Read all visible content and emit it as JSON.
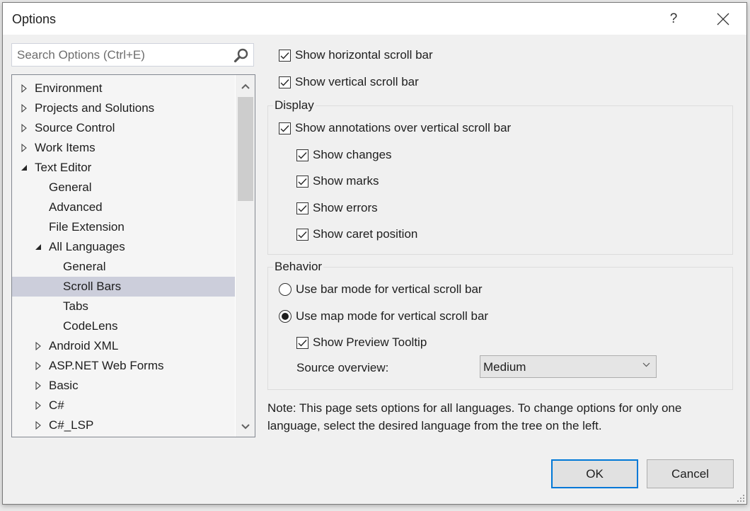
{
  "window": {
    "title": "Options",
    "help_label": "?",
    "close_icon": "close-icon"
  },
  "search": {
    "placeholder": "Search Options (Ctrl+E)",
    "value": "",
    "icon": "search-icon"
  },
  "tree": {
    "items": [
      {
        "label": "Environment",
        "level": 0,
        "state": "collapsed"
      },
      {
        "label": "Projects and Solutions",
        "level": 0,
        "state": "collapsed"
      },
      {
        "label": "Source Control",
        "level": 0,
        "state": "collapsed"
      },
      {
        "label": "Work Items",
        "level": 0,
        "state": "collapsed"
      },
      {
        "label": "Text Editor",
        "level": 0,
        "state": "expanded"
      },
      {
        "label": "General",
        "level": 1,
        "state": "leaf"
      },
      {
        "label": "Advanced",
        "level": 1,
        "state": "leaf"
      },
      {
        "label": "File Extension",
        "level": 1,
        "state": "leaf"
      },
      {
        "label": "All Languages",
        "level": 1,
        "state": "expanded"
      },
      {
        "label": "General",
        "level": 2,
        "state": "leaf"
      },
      {
        "label": "Scroll Bars",
        "level": 2,
        "state": "leaf",
        "selected": true
      },
      {
        "label": "Tabs",
        "level": 2,
        "state": "leaf"
      },
      {
        "label": "CodeLens",
        "level": 2,
        "state": "leaf"
      },
      {
        "label": "Android XML",
        "level": 1,
        "state": "collapsed"
      },
      {
        "label": "ASP.NET Web Forms",
        "level": 1,
        "state": "collapsed"
      },
      {
        "label": "Basic",
        "level": 1,
        "state": "collapsed"
      },
      {
        "label": "C#",
        "level": 1,
        "state": "collapsed"
      },
      {
        "label": "C#_LSP",
        "level": 1,
        "state": "collapsed"
      }
    ]
  },
  "options": {
    "show_horizontal": {
      "label": "Show horizontal scroll bar",
      "checked": true
    },
    "show_vertical": {
      "label": "Show vertical scroll bar",
      "checked": true
    },
    "display": {
      "title": "Display",
      "show_annotations": {
        "label": "Show annotations over vertical scroll bar",
        "checked": true
      },
      "show_changes": {
        "label": "Show changes",
        "checked": true
      },
      "show_marks": {
        "label": "Show marks",
        "checked": true
      },
      "show_errors": {
        "label": "Show errors",
        "checked": true
      },
      "show_caret": {
        "label": "Show caret position",
        "checked": true
      }
    },
    "behavior": {
      "title": "Behavior",
      "bar_mode": {
        "label": "Use bar mode for vertical scroll bar",
        "selected": false
      },
      "map_mode": {
        "label": "Use map mode for vertical scroll bar",
        "selected": true
      },
      "show_preview": {
        "label": "Show Preview Tooltip",
        "checked": true
      },
      "source_overview_label": "Source overview:",
      "source_overview_value": "Medium"
    }
  },
  "note": "Note: This page sets options for all languages. To change options for only one language, select the desired language from the tree on the left.",
  "buttons": {
    "ok": "OK",
    "cancel": "Cancel"
  },
  "colors": {
    "accent": "#0078d7",
    "selection": "#cccedb",
    "dialog_bg": "#f0f0f0"
  }
}
